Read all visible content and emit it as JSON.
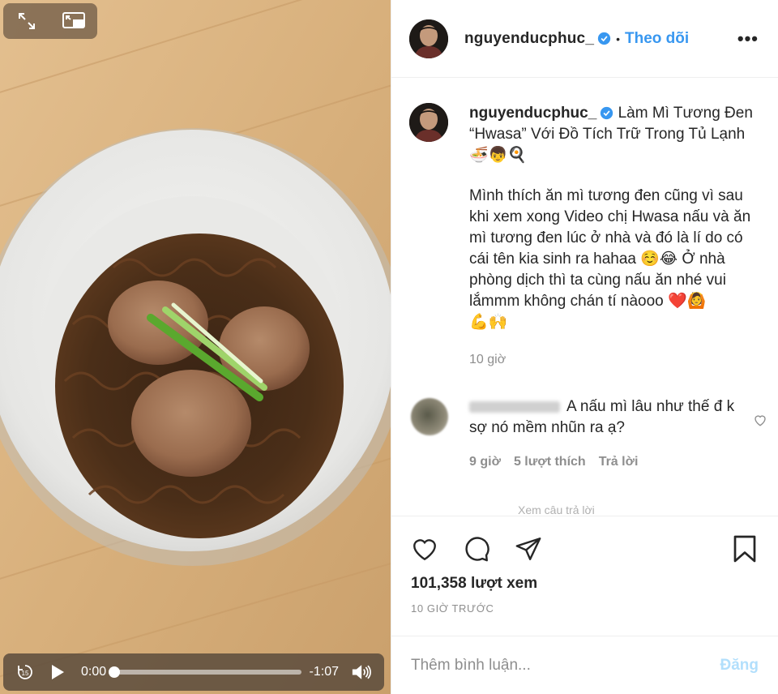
{
  "media": {
    "player": {
      "elapsed": "0:00",
      "remaining": "-1:07",
      "progress": 0
    }
  },
  "header": {
    "username": "nguyenducphuc_",
    "separator": "•",
    "follow_label": "Theo dõi",
    "more_label": "•••"
  },
  "caption": {
    "username": "nguyenducphuc_",
    "title_text": "Làm Mì Tương Đen “Hwasa” Với Đồ Tích Trữ Trong Tủ Lạnh",
    "title_emoji": "🍜👦🍳",
    "body_text": "Mình thích ăn mì tương đen cũng vì sau khi xem xong Video chị Hwasa nấu và ăn mì tương đen lúc ở nhà và đó là lí do có cái tên kia sinh ra hahaa ☺️😂 Ở nhà phòng dịch thì ta cùng nấu ăn nhé vui lắmmm không chán tí nàooo ❤️🙆",
    "body_emoji": "💪🙌",
    "time": "10 giờ"
  },
  "comment": {
    "text": "A nấu mì lâu như thế đ k sợ nó mềm nhũn ra ạ?",
    "time": "9 giờ",
    "likes": "5 lượt thích",
    "reply_label": "Trả lời",
    "view_replies": "Xem câu trả lời"
  },
  "stats": {
    "views": "101,358 lượt xem",
    "posted": "10 GIỜ TRƯỚC"
  },
  "composer": {
    "placeholder": "Thêm bình luận...",
    "post_label": "Đăng"
  },
  "colors": {
    "link": "#3897f0",
    "post_disabled": "#b2dffc",
    "verified": "#3897f0",
    "secondary_text": "#8e8e8e"
  }
}
